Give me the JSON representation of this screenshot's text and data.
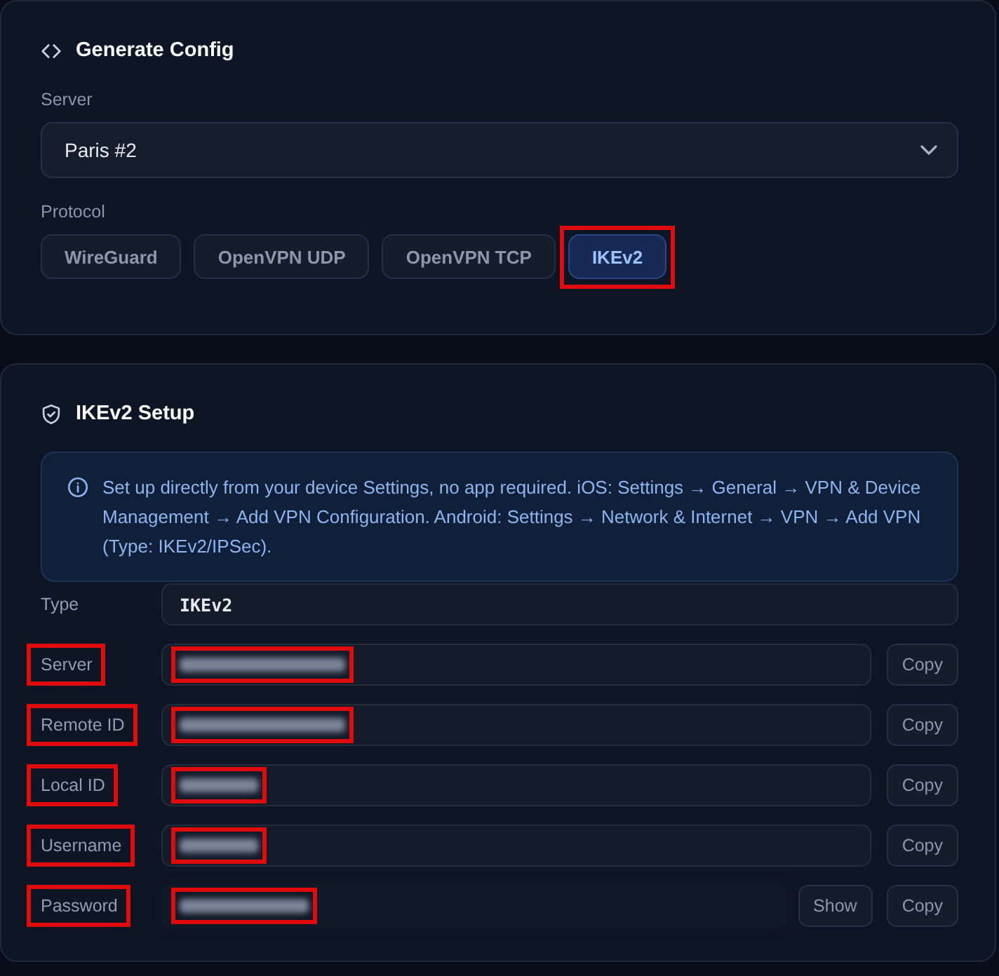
{
  "generate_config": {
    "title": "Generate Config",
    "server": {
      "label": "Server",
      "value": "Paris #2"
    },
    "protocol": {
      "label": "Protocol",
      "options": [
        {
          "label": "WireGuard",
          "selected": false,
          "highlighted": false
        },
        {
          "label": "OpenVPN UDP",
          "selected": false,
          "highlighted": false
        },
        {
          "label": "OpenVPN TCP",
          "selected": false,
          "highlighted": false
        },
        {
          "label": "IKEv2",
          "selected": true,
          "highlighted": true
        }
      ]
    }
  },
  "setup": {
    "title": "IKEv2 Setup",
    "info": "Set up directly from your device Settings, no app required. iOS: Settings → General → VPN & Device Management → Add VPN Configuration. Android: Settings → Network & Internet → VPN → Add VPN (Type: IKEv2/IPSec).",
    "fields": [
      {
        "kind": "text",
        "label": "Type",
        "value": "IKEv2",
        "highlighted": false
      },
      {
        "kind": "redacted",
        "label": "Server",
        "buttons": [
          "Copy"
        ],
        "highlighted": true
      },
      {
        "kind": "redacted",
        "label": "Remote ID",
        "buttons": [
          "Copy"
        ],
        "highlighted": true
      },
      {
        "kind": "redacted",
        "label": "Local ID",
        "buttons": [
          "Copy"
        ],
        "highlighted": true
      },
      {
        "kind": "redacted",
        "label": "Username",
        "buttons": [
          "Copy"
        ],
        "highlighted": true
      },
      {
        "kind": "secret",
        "label": "Password",
        "buttons": [
          "Show",
          "Copy"
        ],
        "highlighted": true
      }
    ]
  }
}
